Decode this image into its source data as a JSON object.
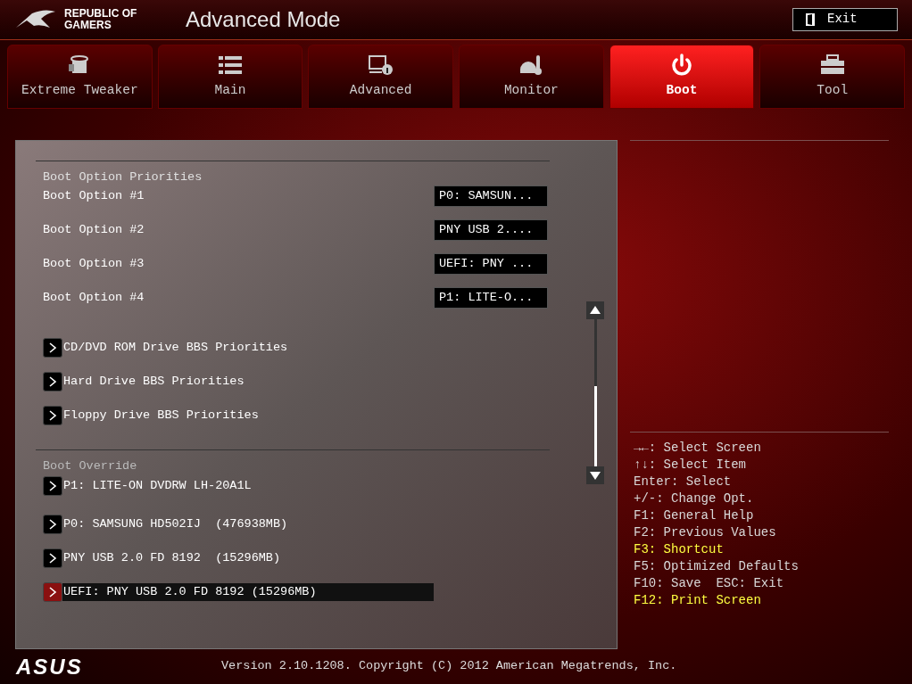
{
  "header": {
    "brand": "REPUBLIC OF GAMERS",
    "title": "Advanced Mode",
    "exit_button": "Exit"
  },
  "tabs": [
    {
      "label": "Extreme Tweaker",
      "selected": false
    },
    {
      "label": "Main",
      "selected": false
    },
    {
      "label": "Advanced",
      "selected": false
    },
    {
      "label": "Monitor",
      "selected": false
    },
    {
      "label": "Boot",
      "selected": true
    },
    {
      "label": "Tool",
      "selected": false
    }
  ],
  "boot_priorities": {
    "heading": "Boot Option Priorities",
    "options": [
      {
        "label": "Boot Option #1",
        "value": "P0: SAMSUN..."
      },
      {
        "label": "Boot Option #2",
        "value": "PNY USB 2...."
      },
      {
        "label": "Boot Option #3",
        "value": "UEFI: PNY ..."
      },
      {
        "label": "Boot Option #4",
        "value": "P1: LITE-O..."
      }
    ]
  },
  "submenus": [
    {
      "label": "CD/DVD ROM Drive BBS Priorities",
      "selected": false
    },
    {
      "label": "Hard Drive BBS Priorities",
      "selected": false
    },
    {
      "label": "Floppy Drive BBS Priorities",
      "selected": false
    }
  ],
  "boot_override": {
    "heading": "Boot Override",
    "items": [
      {
        "label": "P1: LITE-ON DVDRW LH-20A1L",
        "selected": false
      },
      {
        "label": "P0: SAMSUNG HD502IJ  (476938MB)",
        "selected": false
      },
      {
        "label": "PNY USB 2.0 FD 8192  (15296MB)",
        "selected": false
      },
      {
        "label": "UEFI: PNY USB 2.0 FD 8192 (15296MB)",
        "selected": true
      }
    ]
  },
  "help": [
    {
      "text": "→←: Select Screen",
      "highlighted": false
    },
    {
      "text": "↑↓: Select Item",
      "highlighted": false
    },
    {
      "text": "Enter: Select",
      "highlighted": false
    },
    {
      "text": "+/-: Change Opt.",
      "highlighted": false
    },
    {
      "text": "F1: General Help",
      "highlighted": false
    },
    {
      "text": "F2: Previous Values",
      "highlighted": false
    },
    {
      "text": "F3: Shortcut",
      "highlighted": true
    },
    {
      "text": "F5: Optimized Defaults",
      "highlighted": false
    },
    {
      "text": "F10: Save  ESC: Exit",
      "highlighted": false
    },
    {
      "text": "F12: Print Screen",
      "highlighted": true
    }
  ],
  "footer": {
    "logo": "ASUS",
    "version": "Version 2.10.1208. Copyright (C) 2012 American Megatrends, Inc."
  }
}
